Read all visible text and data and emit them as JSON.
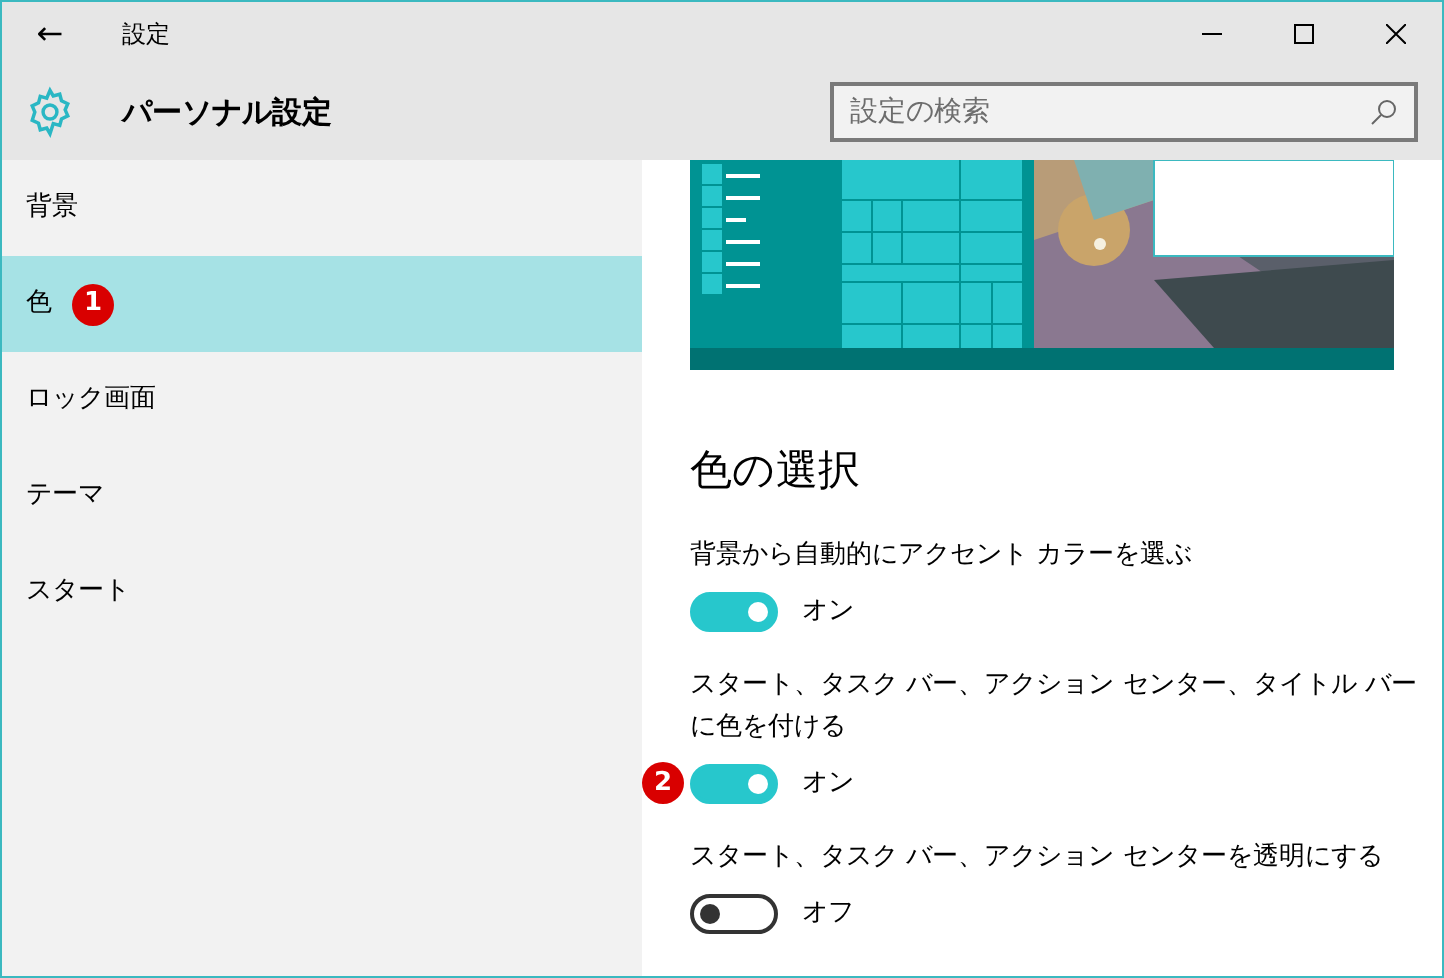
{
  "window": {
    "title": "設定",
    "back": "←"
  },
  "header": {
    "title": "パーソナル設定",
    "search": {
      "placeholder": "設定の検索"
    }
  },
  "sidebar": {
    "items": [
      {
        "label": "背景",
        "selected": false
      },
      {
        "label": "色",
        "selected": true,
        "badge": "1"
      },
      {
        "label": "ロック画面",
        "selected": false
      },
      {
        "label": "テーマ",
        "selected": false
      },
      {
        "label": "スタート",
        "selected": false
      }
    ]
  },
  "content": {
    "heading": "色の選択",
    "settings": [
      {
        "label": "背景から自動的にアクセント カラーを選ぶ",
        "on": true,
        "state": "オン"
      },
      {
        "label": "スタート、タスク バー、アクション センター、タイトル バーに色を付ける",
        "on": true,
        "state": "オン",
        "badge": "2"
      },
      {
        "label": "スタート、タスク バー、アクション センターを透明にする",
        "on": false,
        "state": "オフ"
      }
    ]
  }
}
